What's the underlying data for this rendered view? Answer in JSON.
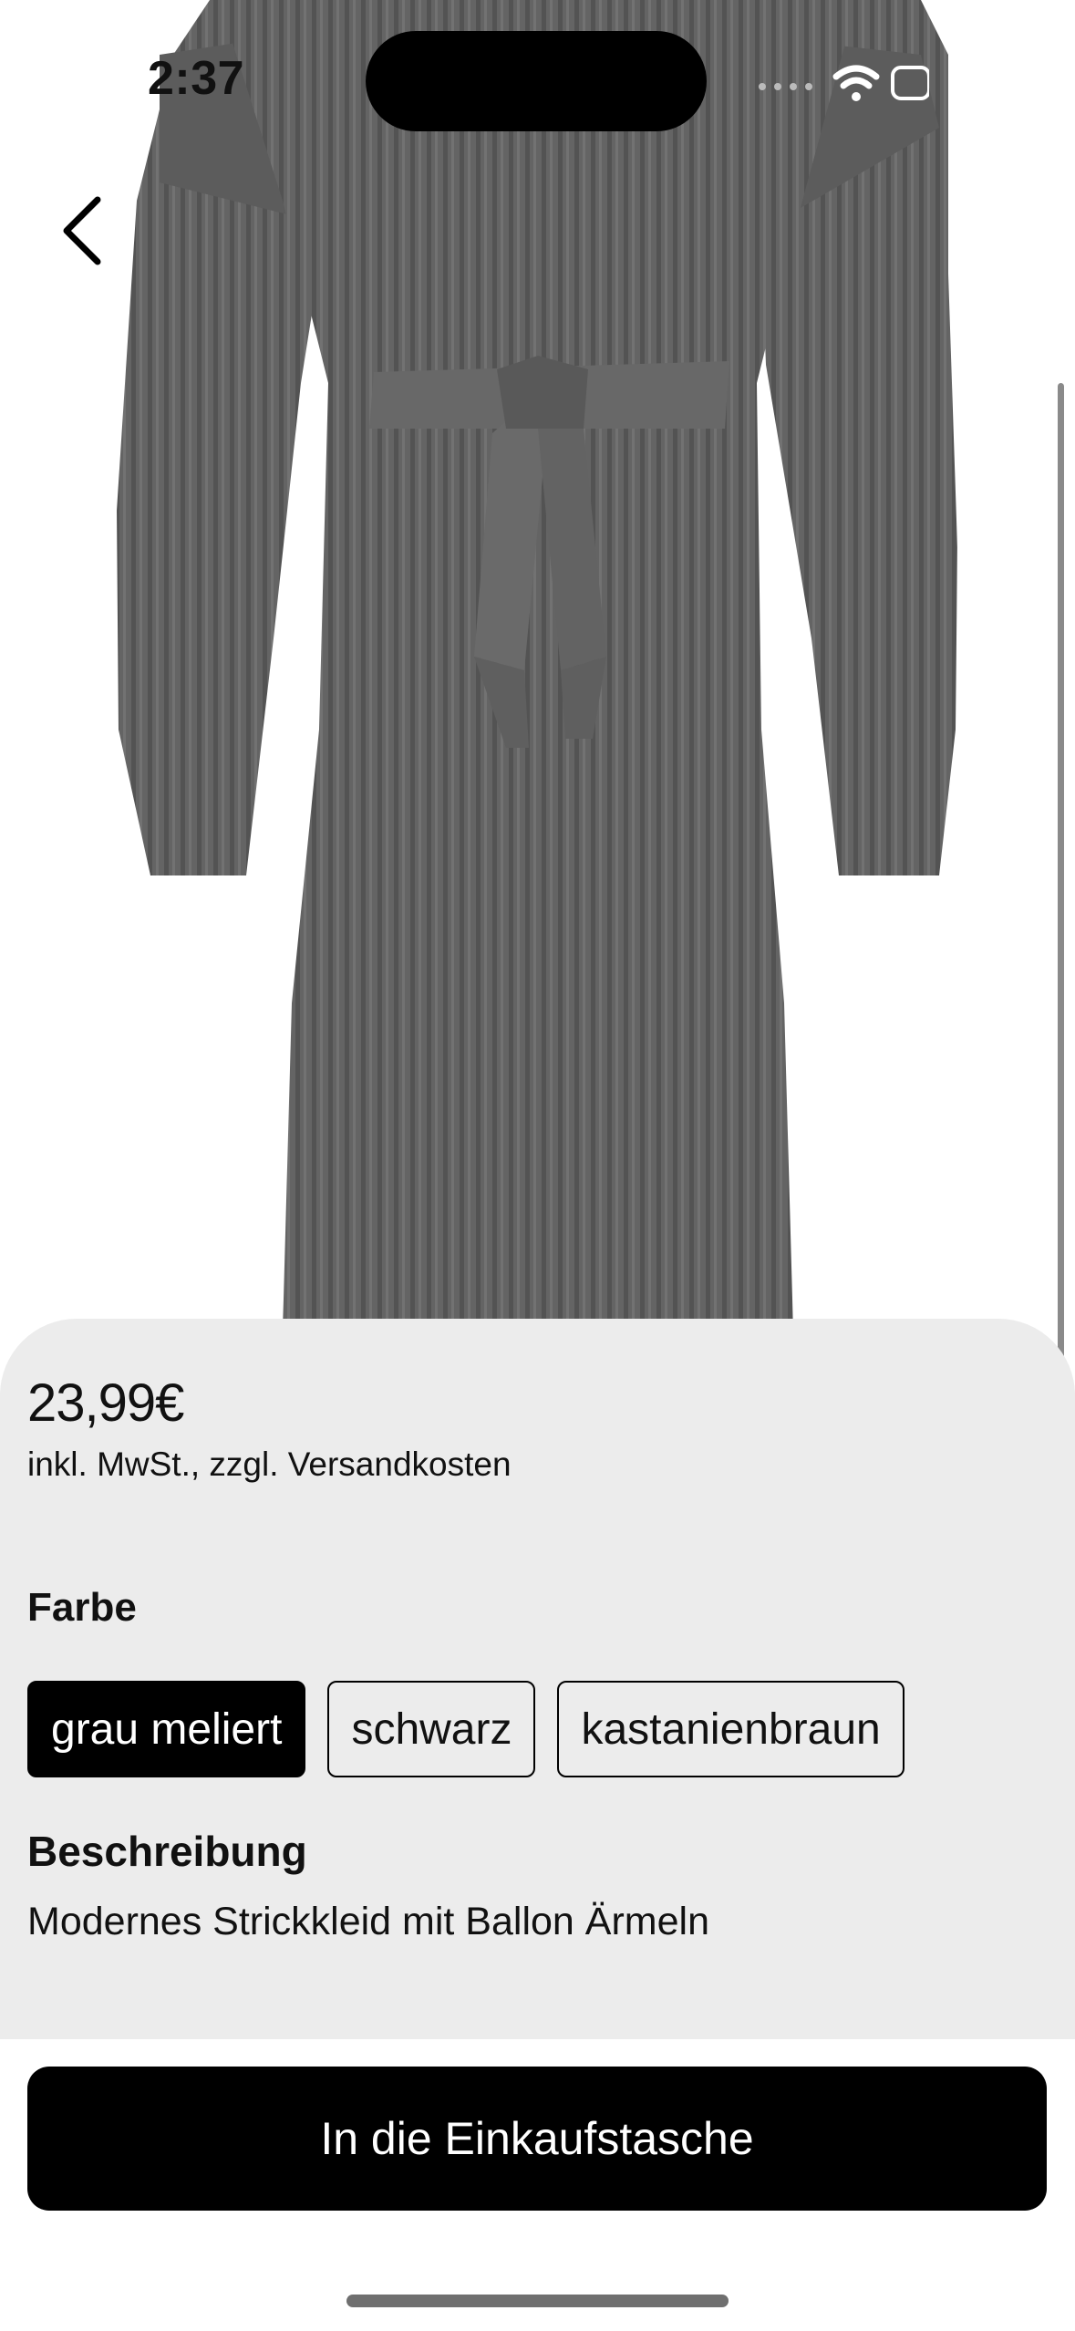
{
  "status_bar": {
    "time": "2:37",
    "icons": [
      "signal-icon",
      "wifi-icon",
      "battery-icon"
    ]
  },
  "navigation": {
    "back_icon": "chevron-left-icon"
  },
  "product": {
    "image_icon": "product-image",
    "price": "23,99€",
    "tax_note": "inkl. MwSt., zzgl. Versandkosten",
    "color_section": {
      "label": "Farbe",
      "options": [
        "grau meliert",
        "schwarz",
        "kastanienbraun"
      ],
      "selected": "grau meliert"
    },
    "description_section": {
      "label": "Beschreibung",
      "text": "Modernes Strickkleid mit Ballon Ärmeln"
    }
  },
  "cta": {
    "label": "In die Einkaufstasche"
  },
  "colors": {
    "sheet": "#ececec",
    "primary": "#000000",
    "dress": "#616161"
  }
}
